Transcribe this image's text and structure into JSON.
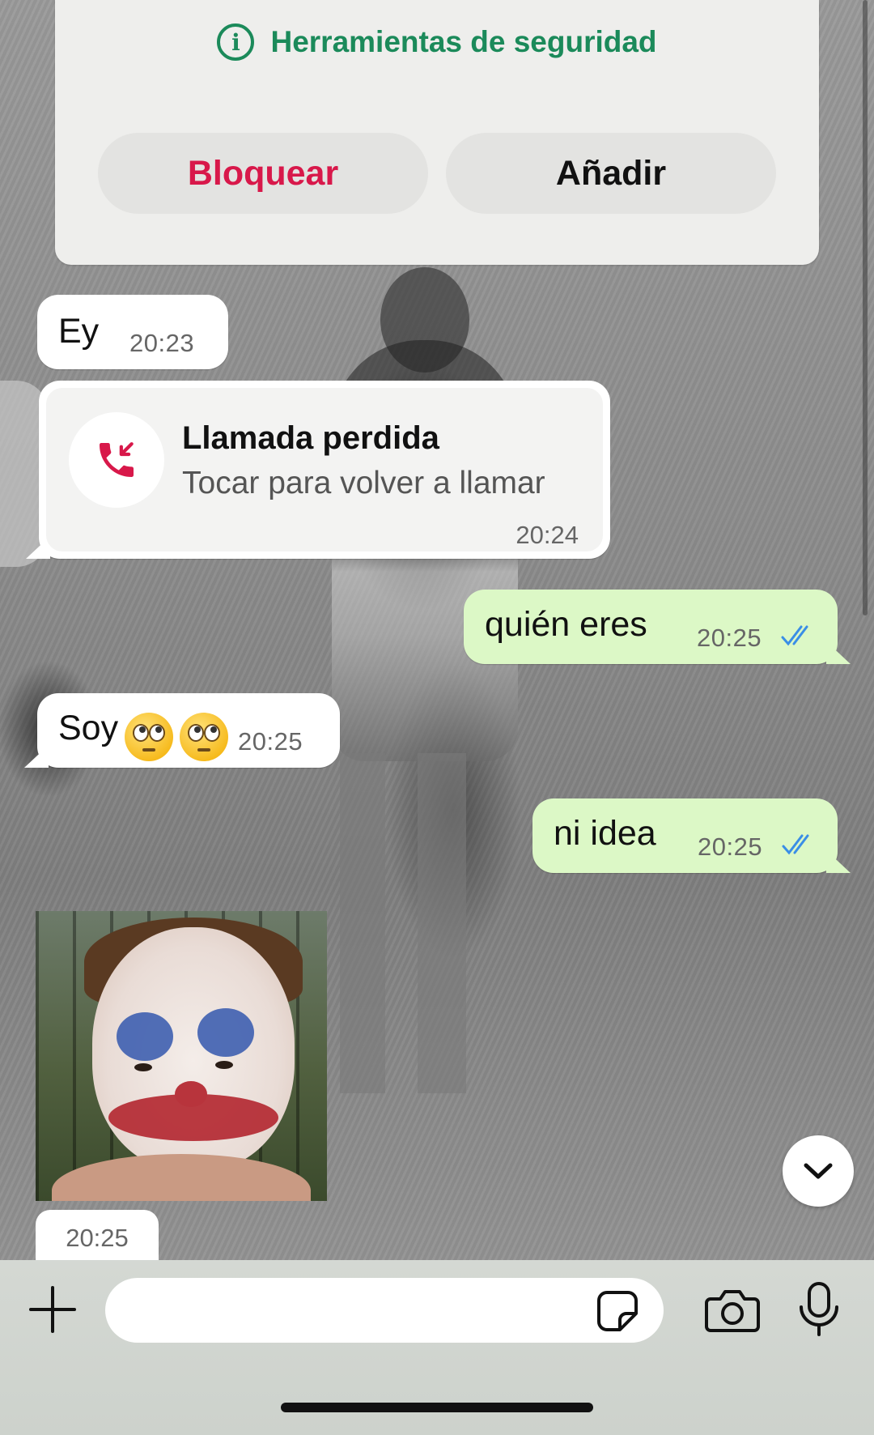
{
  "security": {
    "link_label": "Herramientas de seguridad",
    "block_label": "Bloquear",
    "add_label": "Añadir"
  },
  "messages": [
    {
      "direction": "in",
      "text": "Ey",
      "time": "20:23"
    },
    {
      "direction": "in",
      "type": "missed_call",
      "title": "Llamada perdida",
      "subtitle": "Tocar para volver a llamar",
      "time": "20:24"
    },
    {
      "direction": "out",
      "text": "quién eres",
      "time": "20:25",
      "status": "read"
    },
    {
      "direction": "in",
      "text": "Soy",
      "emojis": [
        "face-with-rolling-eyes",
        "face-with-rolling-eyes"
      ],
      "time": "20:25"
    },
    {
      "direction": "out",
      "text": "ni idea",
      "time": "20:25",
      "status": "read"
    },
    {
      "direction": "in",
      "type": "image",
      "time": "20:25"
    }
  ],
  "composer": {
    "placeholder": "",
    "icons": [
      "plus-icon",
      "sticker-icon",
      "camera-icon",
      "microphone-icon"
    ]
  },
  "colors": {
    "outgoing_bubble": "#dcf8c6",
    "incoming_bubble": "#ffffff",
    "security_green": "#1b8a5a",
    "block_red": "#d8184a",
    "read_ticks": "#3a8ee6",
    "missed_call_red": "#d8184a"
  }
}
